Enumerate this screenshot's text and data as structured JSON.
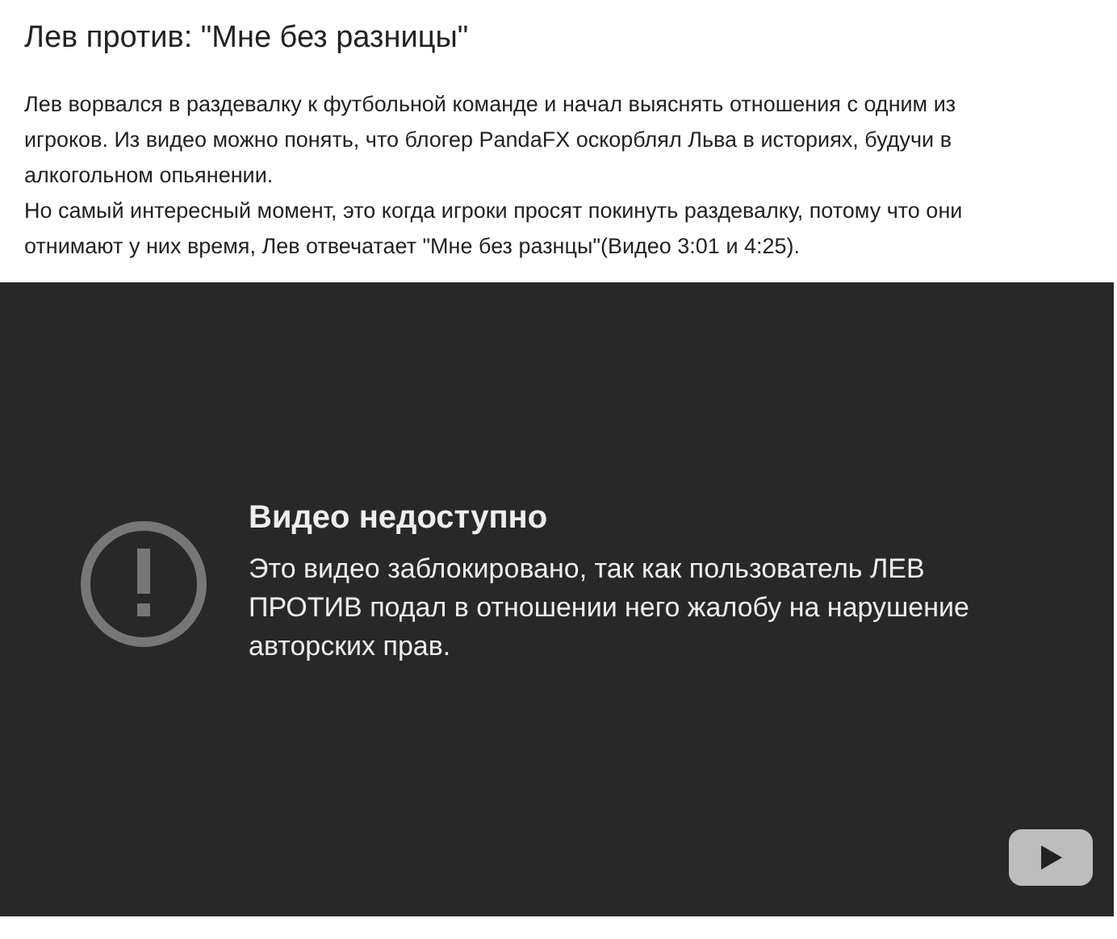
{
  "post": {
    "title": "Лев против: \"Мне без разницы\"",
    "paragraphs": [
      "Лев ворвался в раздевалку к футбольной команде и начал выяснять отношения с одним из игроков. Из видео можно понять, что блогер PandaFX оскорблял Льва в историях, будучи в алкогольном опьянении.",
      "Но самый интересный момент, это когда игроки просят покинуть раздевалку, потому что они отнимают у них время, Лев отвечатает \"Мне без разнцы\"(Видео 3:01 и 4:25)."
    ]
  },
  "player": {
    "error_title": "Видео недоступно",
    "error_message": "Это видео заблокировано, так как пользователь ЛЕВ ПРОТИВ подал в отношении него жалобу на нарушение авторских прав."
  }
}
